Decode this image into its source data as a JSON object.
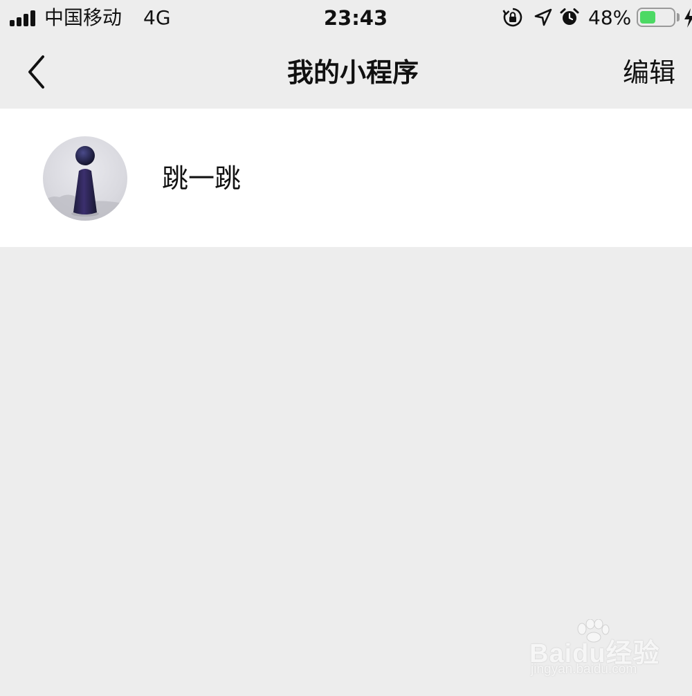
{
  "status_bar": {
    "carrier": "中国移动",
    "network": "4G",
    "time": "23:43",
    "battery_percent": "48%",
    "battery_level": 0.48,
    "icons": [
      "signal-icon",
      "rotation-lock-icon",
      "location-icon",
      "alarm-icon",
      "battery-icon",
      "charging-icon"
    ]
  },
  "nav": {
    "back_icon": "chevron-left-icon",
    "title": "我的小程序",
    "edit_label": "编辑"
  },
  "mini_programs": [
    {
      "name": "跳一跳",
      "icon": "jump-game-icon"
    }
  ],
  "watermark": {
    "brand": "Baidu经验",
    "url": "jingyan.baidu.com"
  },
  "colors": {
    "background": "#ededed",
    "list_background": "#ffffff",
    "battery_green": "#4cd964",
    "text": "#111111"
  }
}
